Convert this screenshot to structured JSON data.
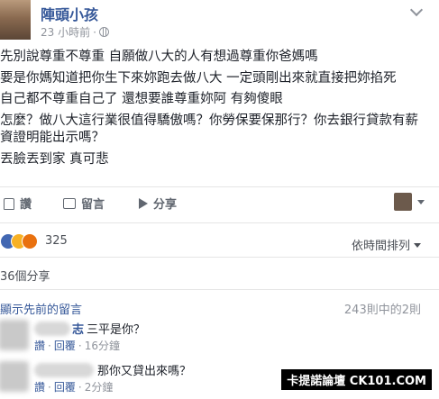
{
  "post": {
    "author": "陣頭小孩",
    "time": "23 小時前",
    "paragraphs": [
      "先別說尊重不尊重 自願做八大的人有想過尊重你爸媽嗎",
      "要是你媽知道把你生下來妳跑去做八大 一定頭剛出來就直接把妳掐死",
      "自己都不尊重自己了 還想要誰尊重妳阿 有夠傻眼",
      "怎麼？做八大這行業很值得驕傲嗎？你勞保要保那行？你去銀行貸款有薪資證明能出示嗎？",
      "丟臉丟到家 真可悲"
    ]
  },
  "actions": {
    "like": "讚",
    "comment": "留言",
    "share": "分享"
  },
  "reactions": {
    "count": "325",
    "sort_label": "依時間排列"
  },
  "shares": "36個分享",
  "comments": {
    "view_previous": "顯示先前的留言",
    "pager": "243則中的2則",
    "items": [
      {
        "name_fragment": "志",
        "text": "三平是你？",
        "like": "讚",
        "reply": "回覆",
        "time": "16分鐘"
      },
      {
        "name_fragment": "",
        "text": "那你又貸出來嗎？",
        "like": "讚",
        "reply": "回覆",
        "time": "2分鐘"
      }
    ]
  },
  "watermark": "卡提諾論壇 CK101.COM",
  "colors": {
    "link": "#365899",
    "text": "#1d2129",
    "meta": "#90949c"
  }
}
